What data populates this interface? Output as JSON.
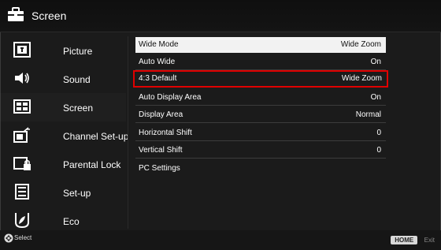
{
  "header": {
    "title": "Screen",
    "icon": "toolbox-icon"
  },
  "menu": {
    "items": [
      {
        "label": "Picture",
        "icon": "picture-icon"
      },
      {
        "label": "Sound",
        "icon": "speaker-icon"
      },
      {
        "label": "Screen",
        "icon": "screen-icon"
      },
      {
        "label": "Channel Set-up",
        "icon": "antenna-icon"
      },
      {
        "label": "Parental Lock",
        "icon": "lock-icon"
      },
      {
        "label": "Set-up",
        "icon": "setup-icon"
      },
      {
        "label": "Eco",
        "icon": "leaf-icon"
      }
    ]
  },
  "settings": {
    "rows": [
      {
        "label": "Wide Mode",
        "value": "Wide Zoom"
      },
      {
        "label": "Auto Wide",
        "value": "On"
      },
      {
        "label": "4:3 Default",
        "value": "Wide Zoom"
      },
      {
        "label": "Auto Display Area",
        "value": "On"
      },
      {
        "label": "Display Area",
        "value": "Normal"
      },
      {
        "label": "Horizontal Shift",
        "value": "0"
      },
      {
        "label": "Vertical Shift",
        "value": "0"
      },
      {
        "label": "PC Settings",
        "value": ""
      }
    ]
  },
  "footer": {
    "select_label": "Select",
    "home_key": "HOME",
    "exit_label": "Exit"
  },
  "colors": {
    "highlight_border": "#e00000",
    "selected_bg": "#f2f2f2",
    "background": "#1b1b1b"
  }
}
